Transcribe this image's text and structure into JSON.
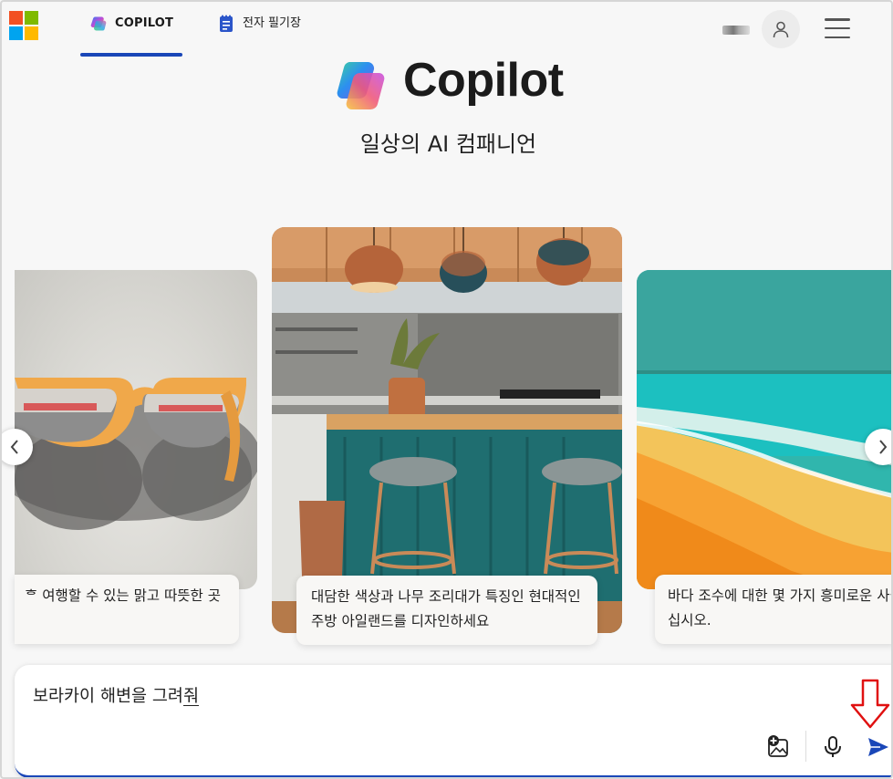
{
  "header": {
    "tabs": [
      {
        "label": "COPILOT",
        "active": true,
        "icon": "copilot-logo-icon"
      },
      {
        "label": "전자 필기장",
        "active": false,
        "icon": "notebook-icon"
      }
    ],
    "icons": [
      "microsoft-logo-icon",
      "user-avatar-icon",
      "hamburger-menu-icon"
    ]
  },
  "hero": {
    "title": "Copilot",
    "subtitle": "일상의 AI 컴패니언"
  },
  "carousel": {
    "cards": [
      {
        "caption": "ᄒ 여행할 수 있는 맑고 따뜻한 곳",
        "image": "sunglasses"
      },
      {
        "caption": "대담한 색상과 나무 조리대가 특징인 현대적인 주방 아일랜드를 디자인하세요",
        "image": "kitchen-island"
      },
      {
        "caption": "바다 조수에 대한 몇 가지 흥미로운 사실을 공유하십시오.",
        "image": "beach"
      }
    ],
    "prev_icon": "chevron-left-icon",
    "next_icon": "chevron-right-icon"
  },
  "composer": {
    "value_main": "보라카이 해변을 그려",
    "value_composing": "줘",
    "icons": [
      "add-image-icon",
      "microphone-icon",
      "send-icon"
    ]
  },
  "colors": {
    "accent": "#1a47b8",
    "background": "#f7f7f7",
    "annotation": "#e01010"
  }
}
